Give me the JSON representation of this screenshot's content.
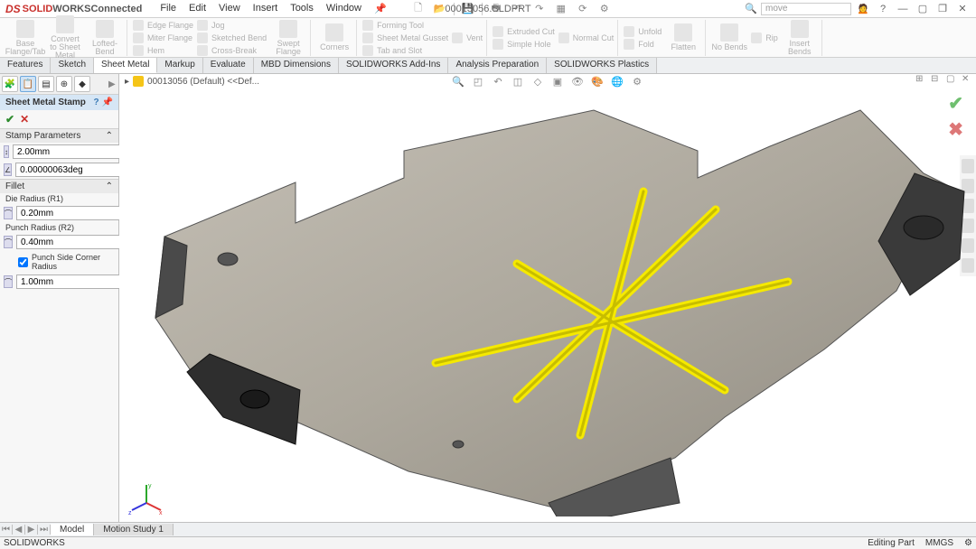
{
  "app": {
    "brand_ds": "DS",
    "brand_solid": "SOLID",
    "brand_works": "WORKS",
    "brand_suffix": " Connected"
  },
  "menu": {
    "file": "File",
    "edit": "Edit",
    "view": "View",
    "insert": "Insert",
    "tools": "Tools",
    "window": "Window"
  },
  "doc_title": "00013056.SLDPRT",
  "search_placeholder": "move",
  "ribbon": {
    "base_flange": "Base Flange/Tab",
    "convert": "Convert to Sheet Metal",
    "lofted": "Lofted-Bend",
    "edge_flange": "Edge Flange",
    "miter_flange": "Miter Flange",
    "hem": "Hem",
    "jog": "Jog",
    "sketched_bend": "Sketched Bend",
    "cross_break": "Cross-Break",
    "swept_flange": "Swept Flange",
    "corners": "Corners",
    "forming_tool": "Forming Tool",
    "gusset": "Sheet Metal Gusset",
    "tab_slot": "Tab and Slot",
    "vent": "Vent",
    "extruded_cut": "Extruded Cut",
    "simple_hole": "Simple Hole",
    "normal_cut": "Normal Cut",
    "unfold": "Unfold",
    "fold": "Fold",
    "flatten": "Flatten",
    "no_bends": "No Bends",
    "rip": "Rip",
    "insert_bends": "Insert Bends"
  },
  "tabs": {
    "features": "Features",
    "sketch": "Sketch",
    "sheet_metal": "Sheet Metal",
    "markup": "Markup",
    "evaluate": "Evaluate",
    "mbd": "MBD Dimensions",
    "addins": "SOLIDWORKS Add-Ins",
    "analysis": "Analysis Preparation",
    "plastics": "SOLIDWORKS Plastics"
  },
  "pm": {
    "feature_name": "Sheet Metal Stamp",
    "sec_params": "Stamp Parameters",
    "depth": "2.00mm",
    "angle": "0.00000063deg",
    "sec_fillet": "Fillet",
    "die_radius_lbl": "Die Radius (R1)",
    "die_radius": "0.20mm",
    "punch_radius_lbl": "Punch Radius (R2)",
    "punch_radius": "0.40mm",
    "punch_side_chk": "Punch Side Corner Radius",
    "corner_radius": "1.00mm"
  },
  "tree": {
    "root": "00013056 (Default) <<Def..."
  },
  "bottom": {
    "model": "Model",
    "motion": "Motion Study 1"
  },
  "status": {
    "app": "SOLIDWORKS",
    "mode": "Editing Part",
    "units": "MMGS"
  }
}
